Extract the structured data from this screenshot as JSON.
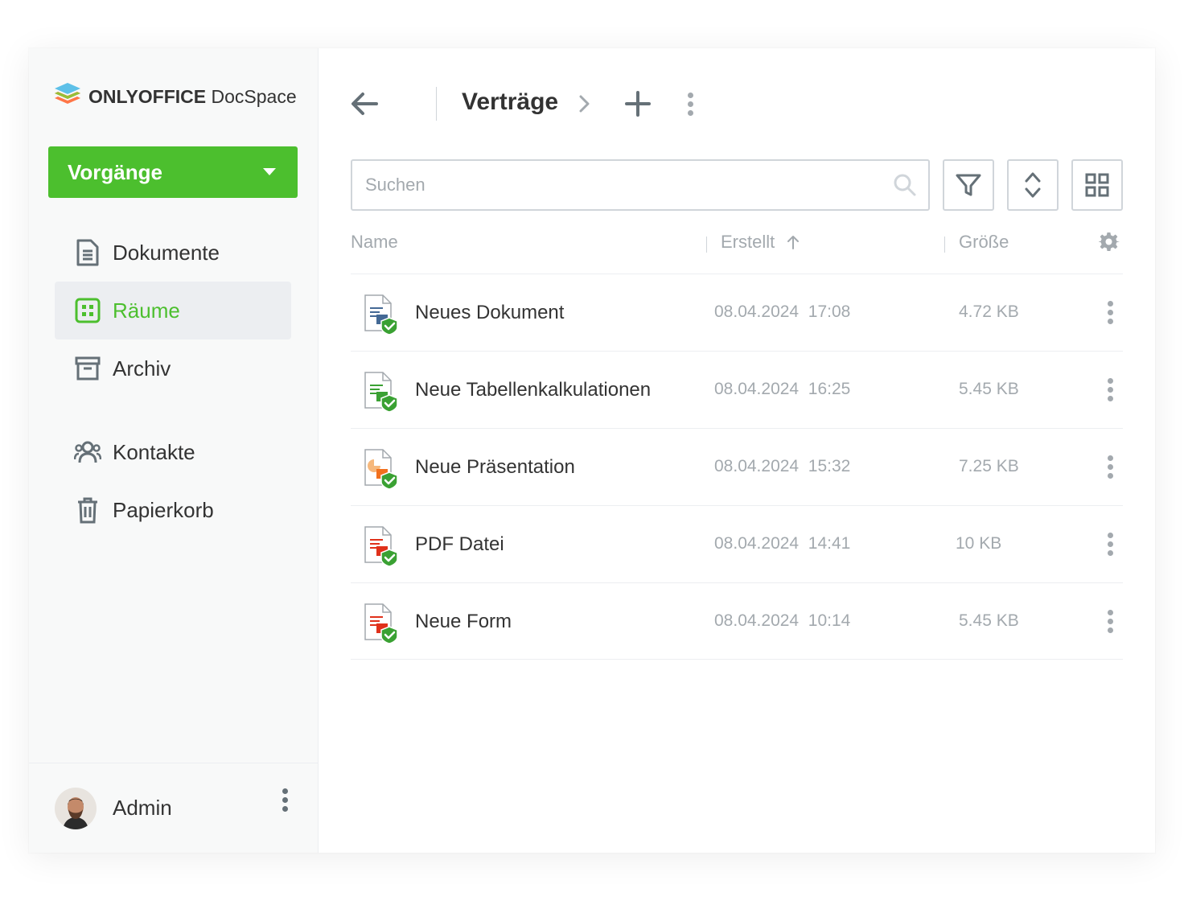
{
  "app": {
    "logo_brand": "ONLYOFFICE",
    "logo_product": "DocSpace"
  },
  "sidebar": {
    "action_button": "Vorgänge",
    "items": [
      {
        "label": "Dokumente",
        "icon": "document-icon",
        "active": false
      },
      {
        "label": "Räume",
        "icon": "rooms-icon",
        "active": true
      },
      {
        "label": "Archiv",
        "icon": "archive-icon",
        "active": false
      },
      {
        "label": "Kontakte",
        "icon": "contacts-icon",
        "active": false
      },
      {
        "label": "Papierkorb",
        "icon": "trash-icon",
        "active": false
      }
    ],
    "profile": {
      "name": "Admin"
    }
  },
  "header": {
    "title": "Verträge"
  },
  "search": {
    "placeholder": "Suchen"
  },
  "table": {
    "columns": [
      "Name",
      "Erstellt",
      "Größe"
    ],
    "sort_column": "Erstellt",
    "sort_direction": "asc",
    "rows": [
      {
        "name": "Neues Dokument",
        "date": "08.04.2024",
        "time": "17:08",
        "size": "4.72 KB",
        "type": "document"
      },
      {
        "name": "Neue Tabellenkalkulationen",
        "date": "08.04.2024",
        "time": "16:25",
        "size": "5.45 KB",
        "type": "spreadsheet"
      },
      {
        "name": "Neue Präsentation",
        "date": "08.04.2024",
        "time": "15:32",
        "size": "7.25 KB",
        "type": "presentation"
      },
      {
        "name": "PDF Datei",
        "date": "08.04.2024",
        "time": "14:41",
        "size": "10 KB",
        "type": "pdf"
      },
      {
        "name": "Neue Form",
        "date": "08.04.2024",
        "time": "10:14",
        "size": "5.45 KB",
        "type": "form"
      }
    ]
  },
  "colors": {
    "accent": "#4cbf2e",
    "text": "#333333",
    "muted": "#a3a9ae",
    "document": "#446995",
    "spreadsheet": "#3aa133",
    "presentation": "#f2701d",
    "pdf": "#e0311b",
    "form": "#e0311b"
  }
}
